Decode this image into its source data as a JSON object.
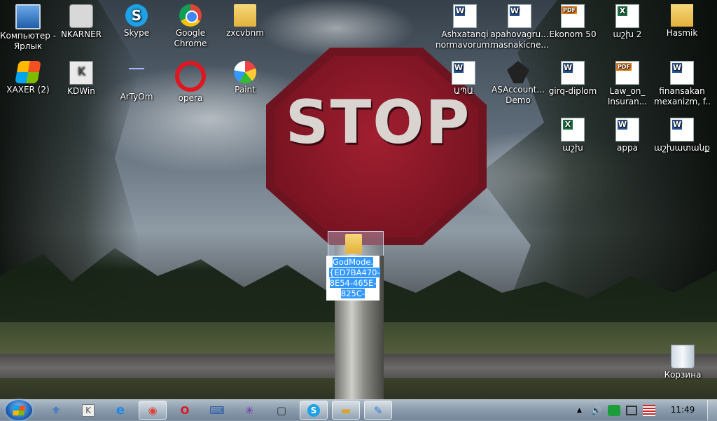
{
  "desktop": {
    "icons": [
      {
        "label": "Компьютер -",
        "label2": "Ярлык",
        "icon": "computer-icon"
      },
      {
        "label": "NKARNER",
        "label2": "",
        "icon": "camera-app-icon"
      },
      {
        "label": "Skype",
        "label2": "",
        "icon": "skype-icon"
      },
      {
        "label": "Google",
        "label2": "Chrome",
        "icon": "chrome-icon"
      },
      {
        "label": "zxcvbnm",
        "label2": "",
        "icon": "folder-icon"
      },
      {
        "label": "XAXER (2)",
        "label2": "",
        "icon": "xaxer-icon"
      },
      {
        "label": "KDWin",
        "label2": "",
        "icon": "kdwin-icon"
      },
      {
        "label": "ArTyOm",
        "label2": "",
        "icon": "artyom-icon"
      },
      {
        "label": "opera",
        "label2": "",
        "icon": "opera-icon"
      },
      {
        "label": "Paint",
        "label2": "",
        "icon": "paint-icon"
      },
      {
        "label": "Ashxatanqi",
        "label2": "normavorum...",
        "icon": "word-doc-icon"
      },
      {
        "label": "apahovagru...",
        "label2": "masnakicne...",
        "icon": "word-doc-icon"
      },
      {
        "label": "Ekonom 50",
        "label2": "",
        "icon": "pdf-icon"
      },
      {
        "label": "աշխ 2",
        "label2": "",
        "icon": "excel-icon"
      },
      {
        "label": "Hasmik",
        "label2": "",
        "icon": "user-folder-icon"
      },
      {
        "label": "ԱՊԱ",
        "label2": "",
        "icon": "word-doc-icon"
      },
      {
        "label": "ASAccount...",
        "label2": "Demo",
        "icon": "asaccount-icon"
      },
      {
        "label": "girq-diplom",
        "label2": "",
        "icon": "word-doc-icon"
      },
      {
        "label": "Law_on_",
        "label2": "Insuran...",
        "icon": "pdf-icon"
      },
      {
        "label": "finansakan",
        "label2": "mexanizm, f...",
        "icon": "word-doc-icon"
      },
      {
        "label": "աշխ",
        "label2": "",
        "icon": "excel-icon"
      },
      {
        "label": "appa",
        "label2": "",
        "icon": "word-doc-icon"
      },
      {
        "label": "աշխատանք",
        "label2": "",
        "icon": "word-doc-icon"
      },
      {
        "label": "Корзина",
        "label2": "",
        "icon": "recycle-bin-icon"
      }
    ],
    "godmode_folder": {
      "lines": [
        "GodMode.",
        "{ED7BA470-",
        "8E54-465E-",
        "825C-"
      ],
      "icon": "folder-icon"
    },
    "wallpaper_text": "STOP"
  },
  "taskbar": {
    "start_icon": "windows-start-icon",
    "pinned": [
      {
        "name": "media-player-icon",
        "glyph": "⚜",
        "open": false
      },
      {
        "name": "kdwin-taskbar-icon",
        "glyph": "K",
        "open": false
      },
      {
        "name": "internet-explorer-icon",
        "glyph": "e",
        "open": false
      },
      {
        "name": "chrome-taskbar-icon",
        "glyph": "◉",
        "open": true
      },
      {
        "name": "opera-taskbar-icon",
        "glyph": "O",
        "open": false
      },
      {
        "name": "keyboard-icon",
        "glyph": "⌨",
        "open": false
      },
      {
        "name": "spider-icon",
        "glyph": "✳",
        "open": false
      },
      {
        "name": "window-icon",
        "glyph": "▢",
        "open": false
      },
      {
        "name": "skype-taskbar-icon",
        "glyph": "S",
        "open": true
      },
      {
        "name": "explorer-icon",
        "glyph": "▬",
        "open": true
      },
      {
        "name": "paint-taskbar-icon",
        "glyph": "✎",
        "open": true
      }
    ],
    "tray": {
      "up_arrow": "▲",
      "volume": "🔊",
      "clock": "11:49"
    },
    "colors": {
      "selection": "#3399ff",
      "stop_red": "#a11f30"
    }
  }
}
